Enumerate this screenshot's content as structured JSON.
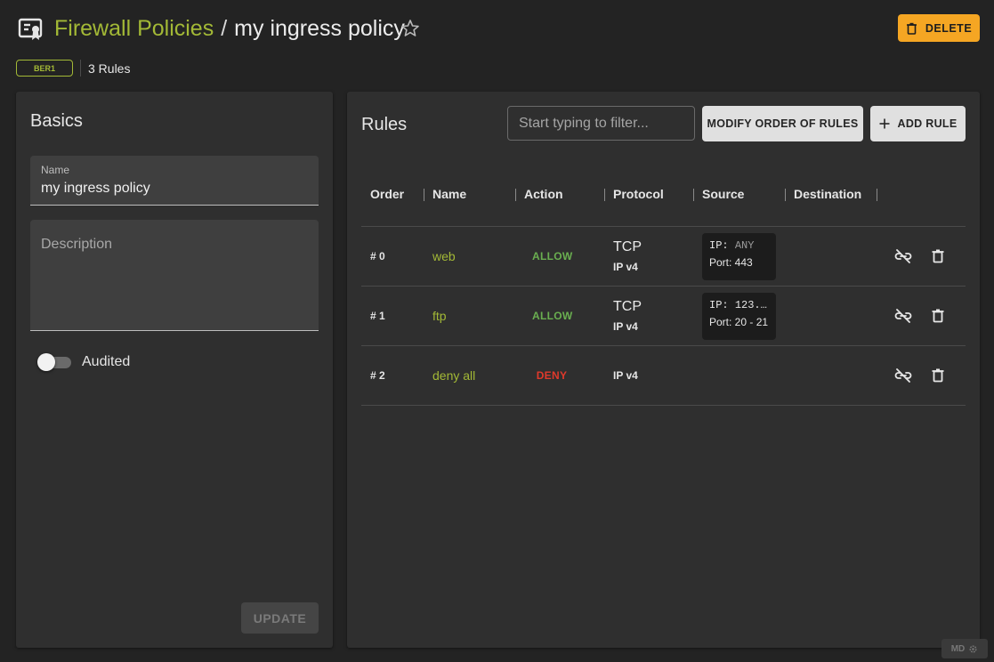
{
  "header": {
    "breadcrumb_parent": "Firewall Policies",
    "separator": "/",
    "title": "my ingress policy",
    "delete_label": "DELETE",
    "location_tag": "BER1",
    "rule_count": "3 Rules"
  },
  "basics": {
    "title": "Basics",
    "name_label": "Name",
    "name_value": "my ingress policy",
    "description_placeholder": "Description",
    "audited_label": "Audited",
    "audited_on": false,
    "update_label": "UPDATE"
  },
  "rules": {
    "title": "Rules",
    "filter_placeholder": "Start typing to filter...",
    "modify_order_label": "MODIFY ORDER OF RULES",
    "add_rule_label": "ADD RULE",
    "columns": [
      "Order",
      "Name",
      "Action",
      "Protocol",
      "Source",
      "Destination"
    ],
    "rows": [
      {
        "order": "# 0",
        "name": "web",
        "action": "ALLOW",
        "protocol": "TCP",
        "ip_version": "IP v4",
        "source_ip_label": "IP:",
        "source_ip": "ANY",
        "source_port": "Port: 443"
      },
      {
        "order": "# 1",
        "name": "ftp",
        "action": "ALLOW",
        "protocol": "TCP",
        "ip_version": "IP v4",
        "source_ip_label": "IP:",
        "source_ip": "123.…",
        "source_port": "Port: 20 - 21"
      },
      {
        "order": "# 2",
        "name": "deny all",
        "action": "DENY",
        "protocol": "",
        "ip_version": "IP v4",
        "source_ip_label": "",
        "source_ip": "",
        "source_port": ""
      }
    ]
  },
  "badge": {
    "label": "MD"
  },
  "colors": {
    "accent": "#a3b936",
    "delete": "#f5a623",
    "allow": "#6aaf50",
    "deny": "#e0392b",
    "background": "#232323",
    "card": "#2f2f2f"
  },
  "icons": {
    "app": "firewall-policy-icon",
    "favorite": "star-outline-icon",
    "delete": "trash-icon",
    "add": "plus-icon",
    "unlink": "link-off-icon",
    "row_delete": "trash-icon"
  }
}
